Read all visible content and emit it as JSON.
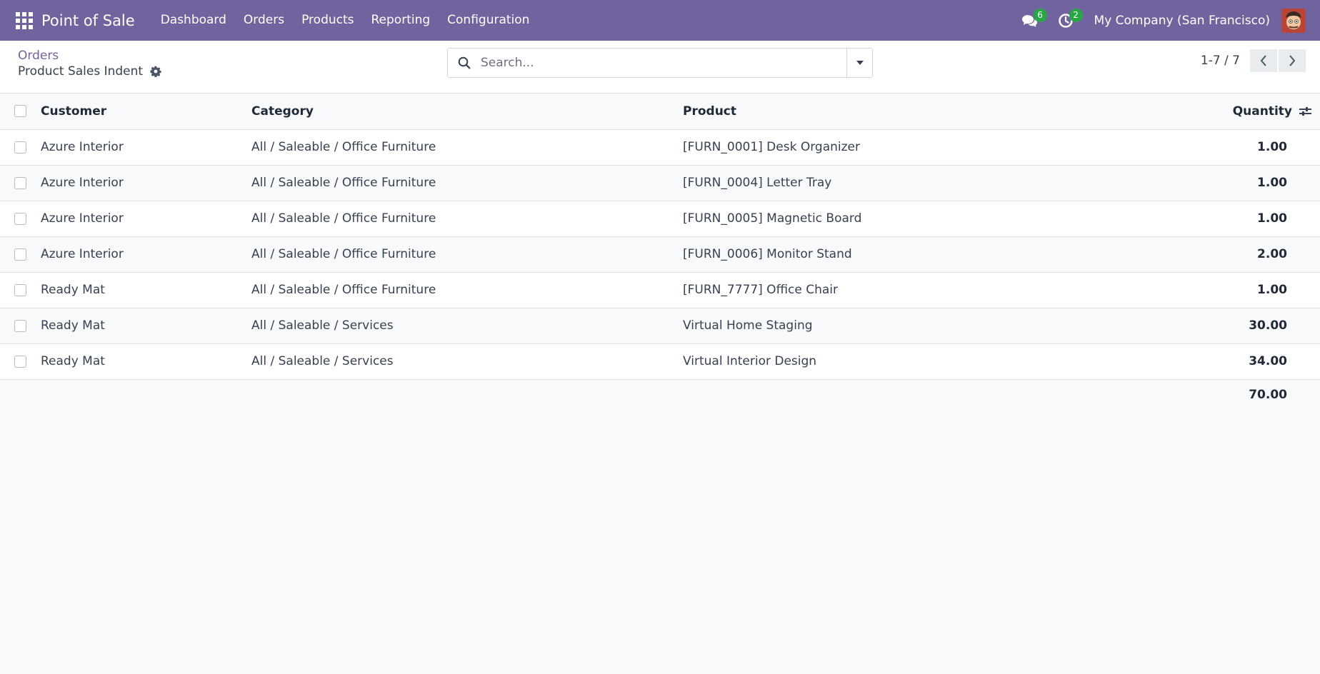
{
  "navbar": {
    "app_name": "Point of Sale",
    "menu": [
      "Dashboard",
      "Orders",
      "Products",
      "Reporting",
      "Configuration"
    ],
    "messages_count": "6",
    "activities_count": "2",
    "company": "My Company (San Francisco)",
    "icons": [
      "apps-grid-icon",
      "chat-icon",
      "clock-icon",
      "user-avatar"
    ]
  },
  "breadcrumb": {
    "parent": "Orders",
    "current": "Product Sales Indent"
  },
  "search": {
    "placeholder": "Search..."
  },
  "pager": {
    "value": "1-7 / 7"
  },
  "table": {
    "columns": [
      "Customer",
      "Category",
      "Product",
      "Quantity"
    ],
    "rows": [
      {
        "customer": "Azure Interior",
        "category": "All / Saleable / Office Furniture",
        "product": "[FURN_0001] Desk Organizer",
        "quantity": "1.00"
      },
      {
        "customer": "Azure Interior",
        "category": "All / Saleable / Office Furniture",
        "product": "[FURN_0004] Letter Tray",
        "quantity": "1.00"
      },
      {
        "customer": "Azure Interior",
        "category": "All / Saleable / Office Furniture",
        "product": "[FURN_0005] Magnetic Board",
        "quantity": "1.00"
      },
      {
        "customer": "Azure Interior",
        "category": "All / Saleable / Office Furniture",
        "product": "[FURN_0006] Monitor Stand",
        "quantity": "2.00"
      },
      {
        "customer": "Ready Mat",
        "category": "All / Saleable / Office Furniture",
        "product": "[FURN_7777] Office Chair",
        "quantity": "1.00"
      },
      {
        "customer": "Ready Mat",
        "category": "All / Saleable / Services",
        "product": "Virtual Home Staging",
        "quantity": "30.00"
      },
      {
        "customer": "Ready Mat",
        "category": "All / Saleable / Services",
        "product": "Virtual Interior Design",
        "quantity": "34.00"
      }
    ],
    "total_quantity": "70.00"
  },
  "colors": {
    "navbar_bg": "#71639e",
    "badge_bg": "#28a745",
    "link": "#71639e"
  }
}
